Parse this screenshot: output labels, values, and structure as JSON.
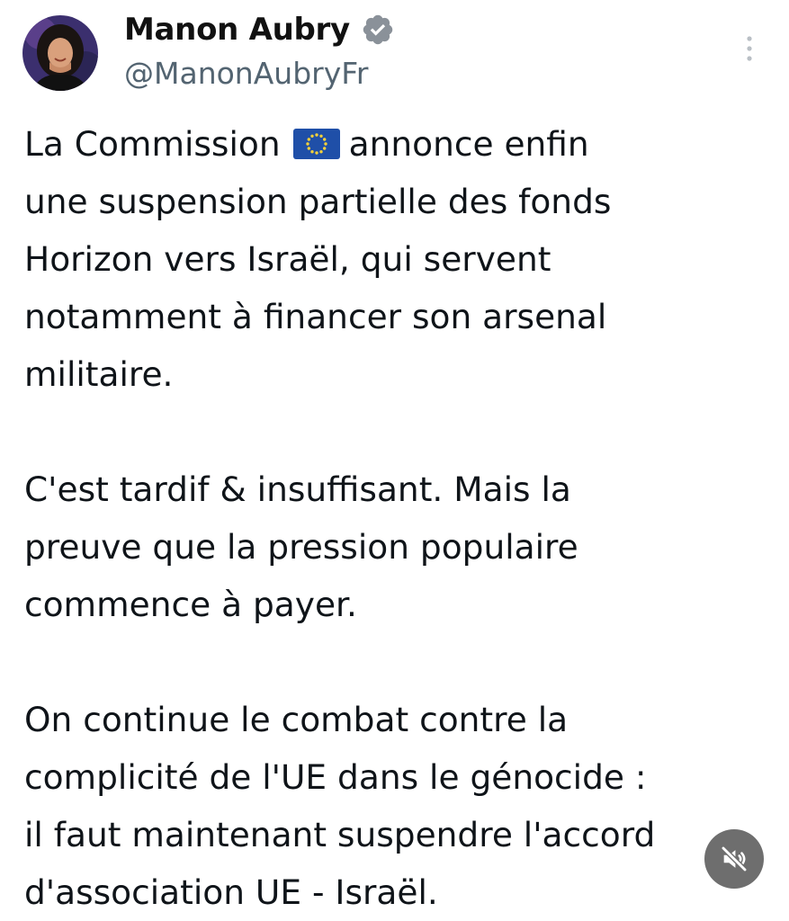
{
  "author": {
    "display_name": "Manon Aubry",
    "handle": "@ManonAubryFr",
    "verified": true,
    "avatar_icon": "profile-photo"
  },
  "tweet": {
    "paragraph1": {
      "line1_before_flag": "La Commission",
      "flag_icon": "eu-flag",
      "line1_after_flag": "annonce enfin",
      "line2": "une suspension partielle des fonds",
      "line3": "Horizon vers Israël, qui servent",
      "line4": "notamment à financer son arsenal",
      "line5": "militaire."
    },
    "paragraph2": {
      "line1": "C'est tardif & insuffisant. Mais la",
      "line2": "preuve que la pression populaire",
      "line3": "commence à payer."
    },
    "paragraph3": {
      "line1": "On continue le combat contre la",
      "line2": "complicité de l'UE dans le génocide :",
      "line3": "il faut maintenant suspendre l'accord",
      "line4": "d'association UE - Israël."
    }
  },
  "controls": {
    "more_icon": "vertical-ellipsis-icon",
    "mute_icon": "speaker-muted-icon"
  },
  "colors": {
    "text": "#0f1419",
    "handle": "#536471",
    "verified_badge": "#8a9199",
    "eu_blue": "#1f4fa8",
    "eu_stars": "#f4d13a",
    "mute_button_bg": "#6e6e6e"
  }
}
